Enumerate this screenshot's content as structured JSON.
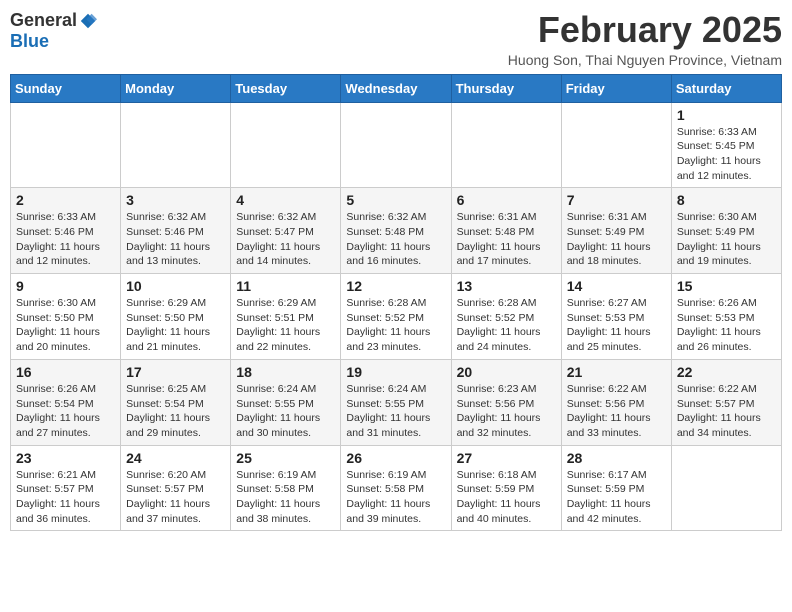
{
  "logo": {
    "general": "General",
    "blue": "Blue"
  },
  "title": {
    "month": "February 2025",
    "location": "Huong Son, Thai Nguyen Province, Vietnam"
  },
  "weekdays": [
    "Sunday",
    "Monday",
    "Tuesday",
    "Wednesday",
    "Thursday",
    "Friday",
    "Saturday"
  ],
  "weeks": [
    [
      {
        "day": "",
        "info": ""
      },
      {
        "day": "",
        "info": ""
      },
      {
        "day": "",
        "info": ""
      },
      {
        "day": "",
        "info": ""
      },
      {
        "day": "",
        "info": ""
      },
      {
        "day": "",
        "info": ""
      },
      {
        "day": "1",
        "info": "Sunrise: 6:33 AM\nSunset: 5:45 PM\nDaylight: 11 hours and 12 minutes."
      }
    ],
    [
      {
        "day": "2",
        "info": "Sunrise: 6:33 AM\nSunset: 5:46 PM\nDaylight: 11 hours and 12 minutes."
      },
      {
        "day": "3",
        "info": "Sunrise: 6:32 AM\nSunset: 5:46 PM\nDaylight: 11 hours and 13 minutes."
      },
      {
        "day": "4",
        "info": "Sunrise: 6:32 AM\nSunset: 5:47 PM\nDaylight: 11 hours and 14 minutes."
      },
      {
        "day": "5",
        "info": "Sunrise: 6:32 AM\nSunset: 5:48 PM\nDaylight: 11 hours and 16 minutes."
      },
      {
        "day": "6",
        "info": "Sunrise: 6:31 AM\nSunset: 5:48 PM\nDaylight: 11 hours and 17 minutes."
      },
      {
        "day": "7",
        "info": "Sunrise: 6:31 AM\nSunset: 5:49 PM\nDaylight: 11 hours and 18 minutes."
      },
      {
        "day": "8",
        "info": "Sunrise: 6:30 AM\nSunset: 5:49 PM\nDaylight: 11 hours and 19 minutes."
      }
    ],
    [
      {
        "day": "9",
        "info": "Sunrise: 6:30 AM\nSunset: 5:50 PM\nDaylight: 11 hours and 20 minutes."
      },
      {
        "day": "10",
        "info": "Sunrise: 6:29 AM\nSunset: 5:50 PM\nDaylight: 11 hours and 21 minutes."
      },
      {
        "day": "11",
        "info": "Sunrise: 6:29 AM\nSunset: 5:51 PM\nDaylight: 11 hours and 22 minutes."
      },
      {
        "day": "12",
        "info": "Sunrise: 6:28 AM\nSunset: 5:52 PM\nDaylight: 11 hours and 23 minutes."
      },
      {
        "day": "13",
        "info": "Sunrise: 6:28 AM\nSunset: 5:52 PM\nDaylight: 11 hours and 24 minutes."
      },
      {
        "day": "14",
        "info": "Sunrise: 6:27 AM\nSunset: 5:53 PM\nDaylight: 11 hours and 25 minutes."
      },
      {
        "day": "15",
        "info": "Sunrise: 6:26 AM\nSunset: 5:53 PM\nDaylight: 11 hours and 26 minutes."
      }
    ],
    [
      {
        "day": "16",
        "info": "Sunrise: 6:26 AM\nSunset: 5:54 PM\nDaylight: 11 hours and 27 minutes."
      },
      {
        "day": "17",
        "info": "Sunrise: 6:25 AM\nSunset: 5:54 PM\nDaylight: 11 hours and 29 minutes."
      },
      {
        "day": "18",
        "info": "Sunrise: 6:24 AM\nSunset: 5:55 PM\nDaylight: 11 hours and 30 minutes."
      },
      {
        "day": "19",
        "info": "Sunrise: 6:24 AM\nSunset: 5:55 PM\nDaylight: 11 hours and 31 minutes."
      },
      {
        "day": "20",
        "info": "Sunrise: 6:23 AM\nSunset: 5:56 PM\nDaylight: 11 hours and 32 minutes."
      },
      {
        "day": "21",
        "info": "Sunrise: 6:22 AM\nSunset: 5:56 PM\nDaylight: 11 hours and 33 minutes."
      },
      {
        "day": "22",
        "info": "Sunrise: 6:22 AM\nSunset: 5:57 PM\nDaylight: 11 hours and 34 minutes."
      }
    ],
    [
      {
        "day": "23",
        "info": "Sunrise: 6:21 AM\nSunset: 5:57 PM\nDaylight: 11 hours and 36 minutes."
      },
      {
        "day": "24",
        "info": "Sunrise: 6:20 AM\nSunset: 5:57 PM\nDaylight: 11 hours and 37 minutes."
      },
      {
        "day": "25",
        "info": "Sunrise: 6:19 AM\nSunset: 5:58 PM\nDaylight: 11 hours and 38 minutes."
      },
      {
        "day": "26",
        "info": "Sunrise: 6:19 AM\nSunset: 5:58 PM\nDaylight: 11 hours and 39 minutes."
      },
      {
        "day": "27",
        "info": "Sunrise: 6:18 AM\nSunset: 5:59 PM\nDaylight: 11 hours and 40 minutes."
      },
      {
        "day": "28",
        "info": "Sunrise: 6:17 AM\nSunset: 5:59 PM\nDaylight: 11 hours and 42 minutes."
      },
      {
        "day": "",
        "info": ""
      }
    ]
  ]
}
